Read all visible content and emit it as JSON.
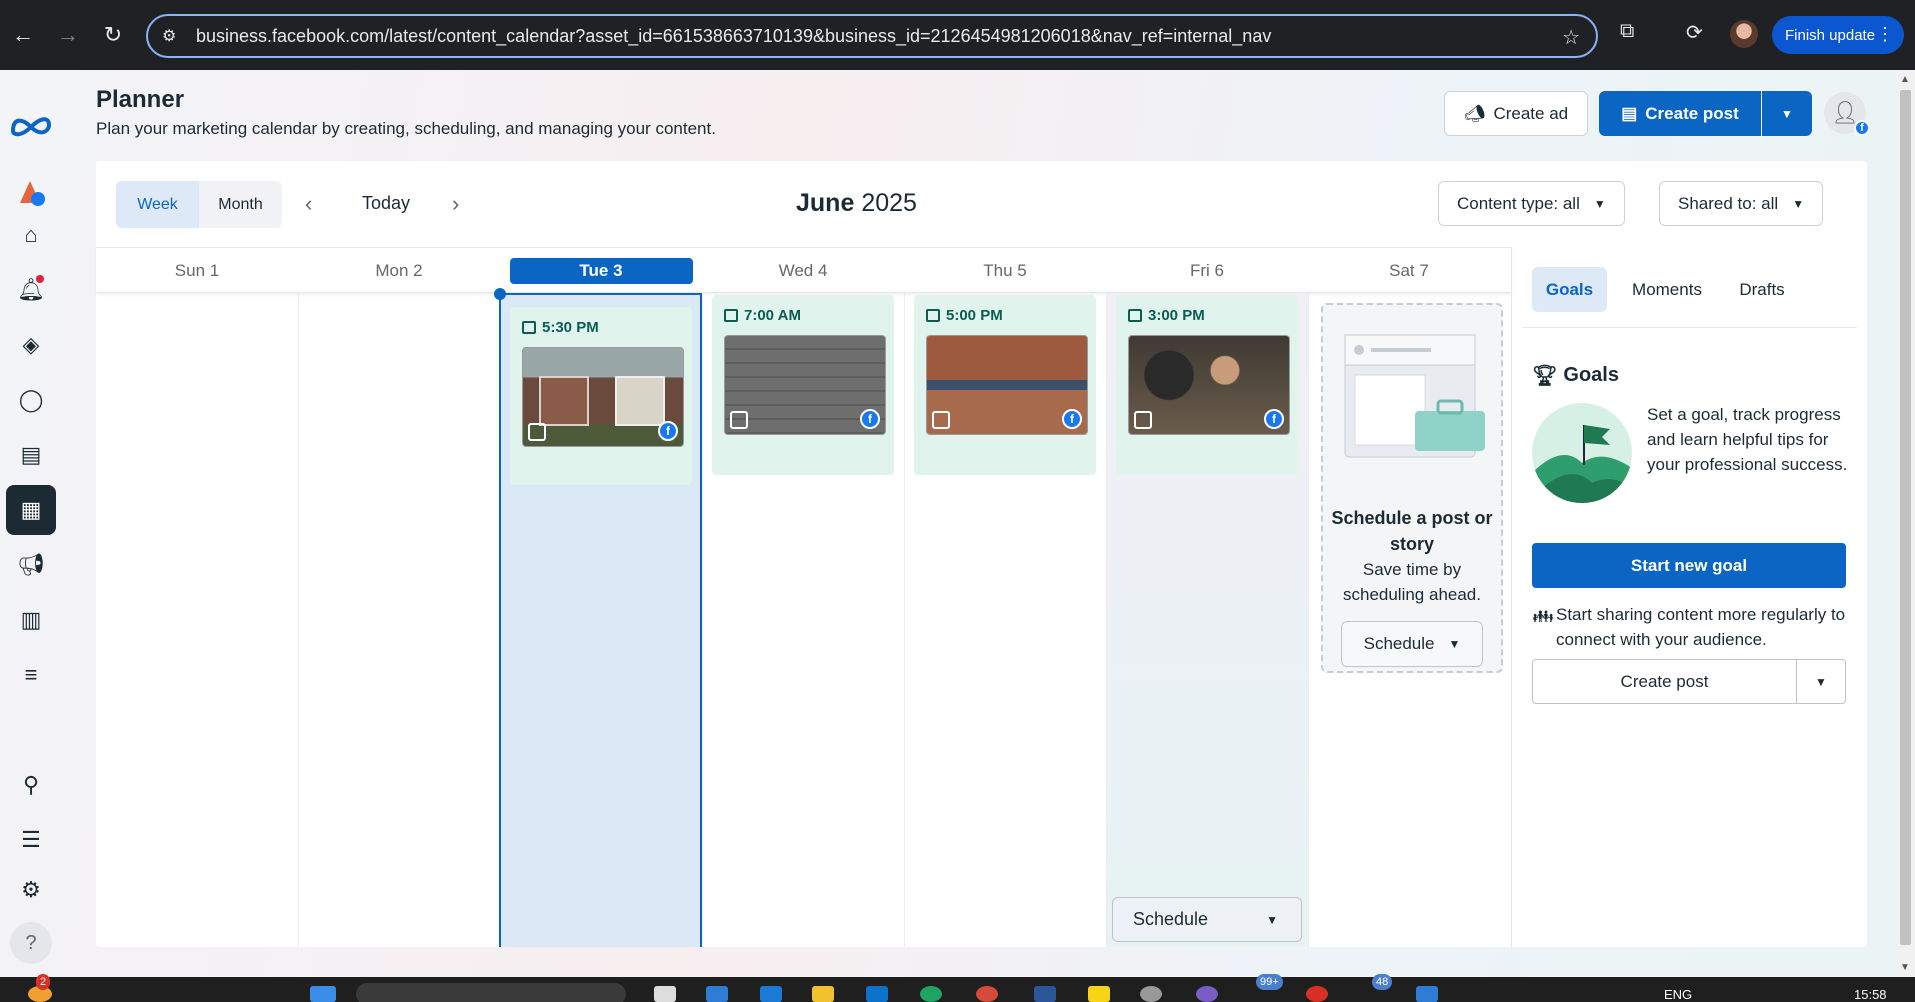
{
  "browser": {
    "url": "business.facebook.com/latest/content_calendar?asset_id=661538663710139&business_id=2126454981206018&nav_ref=internal_nav",
    "finish_update": "Finish update"
  },
  "header": {
    "title": "Planner",
    "subtitle": "Plan your marketing calendar by creating, scheduling, and managing your content.",
    "create_ad": "Create ad",
    "create_post": "Create post"
  },
  "toolbar": {
    "week": "Week",
    "month": "Month",
    "today": "Today",
    "month_name": "June",
    "year": "2025",
    "content_type": "Content type: all",
    "shared_to": "Shared to: all"
  },
  "days": [
    "Sun 1",
    "Mon 2",
    "Tue 3",
    "Wed 4",
    "Thu 5",
    "Fri 6",
    "Sat 7"
  ],
  "posts": [
    {
      "day": "Tue 3",
      "time": "5:30 PM",
      "image": "houses before/after"
    },
    {
      "day": "Wed 4",
      "time": "7:00 AM",
      "image": "cost table"
    },
    {
      "day": "Thu 5",
      "time": "5:00 PM",
      "image": "new build houses"
    },
    {
      "day": "Fri 6",
      "time": "3:00 PM",
      "image": "people meeting"
    }
  ],
  "schedule_card": {
    "title": "Schedule a post or story",
    "text": "Save time by scheduling ahead.",
    "button": "Schedule"
  },
  "fri_schedule_button": "Schedule",
  "panel": {
    "tabs": [
      "Goals",
      "Moments",
      "Drafts"
    ],
    "goals_heading": "Goals",
    "goals_text": "Set a goal, track progress and learn helpful tips for your professional success.",
    "start_goal": "Start new goal",
    "sharing_text": "Start sharing content more regularly to connect with your audience.",
    "create_post": "Create post"
  },
  "taskbar": {
    "notif_count": "2",
    "badge_99": "99+",
    "badge_48": "48",
    "lang": "ENG",
    "clock": "15:58"
  },
  "colors": {
    "brand_blue": "#0a66c2",
    "post_bg": "#e0f4ed",
    "post_time": "#0b5d52"
  }
}
